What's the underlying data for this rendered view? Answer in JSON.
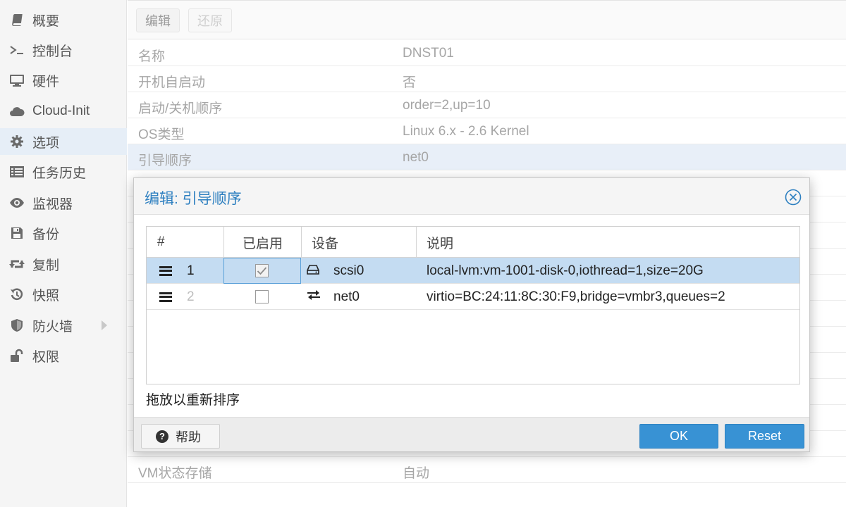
{
  "sidebar": {
    "items": [
      {
        "label": "概要",
        "icon": "book-icon"
      },
      {
        "label": "控制台",
        "icon": "terminal-icon"
      },
      {
        "label": "硬件",
        "icon": "monitor-icon"
      },
      {
        "label": "Cloud-Init",
        "icon": "cloud-icon"
      },
      {
        "label": "选项",
        "icon": "gear-icon"
      },
      {
        "label": "任务历史",
        "icon": "list-icon"
      },
      {
        "label": "监视器",
        "icon": "eye-icon"
      },
      {
        "label": "备份",
        "icon": "floppy-icon"
      },
      {
        "label": "复制",
        "icon": "retweet-icon"
      },
      {
        "label": "快照",
        "icon": "history-icon"
      },
      {
        "label": "防火墙",
        "icon": "shield-icon"
      },
      {
        "label": "权限",
        "icon": "unlock-icon"
      }
    ]
  },
  "toolbar": {
    "edit_label": "编辑",
    "revert_label": "还原"
  },
  "options": {
    "rows": [
      {
        "key": "名称",
        "value": "DNST01"
      },
      {
        "key": "开机自启动",
        "value": "否"
      },
      {
        "key": "启动/关机顺序",
        "value": "order=2,up=10"
      },
      {
        "key": "OS类型",
        "value": "Linux 6.x - 2.6 Kernel"
      },
      {
        "key": "引导顺序",
        "value": "net0"
      }
    ],
    "last_row": {
      "key": "VM状态存储",
      "value": "自动"
    }
  },
  "dialog": {
    "title": "编辑: 引导顺序",
    "columns": [
      "#",
      "已启用",
      "设备",
      "说明"
    ],
    "rows": [
      {
        "num": "1",
        "enabled": true,
        "device": "scsi0",
        "device_icon": "hdd-icon",
        "desc": "local-lvm:vm-1001-disk-0,iothread=1,size=20G"
      },
      {
        "num": "2",
        "enabled": false,
        "device": "net0",
        "device_icon": "exchange-icon",
        "desc": "virtio=BC:24:11:8C:30:F9,bridge=vmbr3,queues=2"
      }
    ],
    "hint": "拖放以重新排序",
    "help_label": "帮助",
    "ok_label": "OK",
    "reset_label": "Reset"
  },
  "colors": {
    "accent": "#3892d4",
    "title": "#2d7fc0",
    "selected_row": "#c4dcf2"
  }
}
